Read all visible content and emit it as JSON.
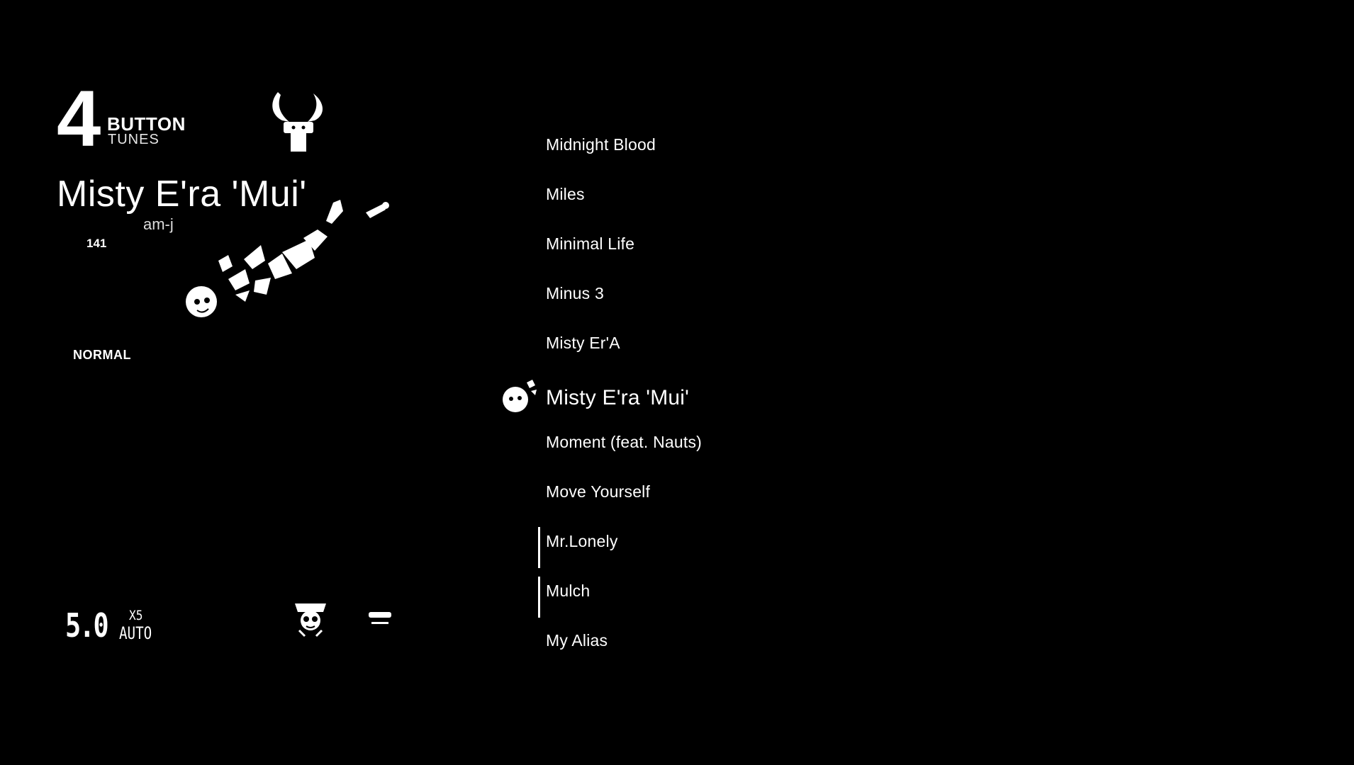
{
  "header": {
    "mode_number": "4",
    "mode_button": "BUTTON",
    "mode_tunes": "TUNES"
  },
  "selected_song": {
    "title": "Misty E'ra 'Mui'",
    "artist": "am-j",
    "bpm": "141",
    "difficulty": "NORMAL"
  },
  "settings": {
    "speed": "5.0",
    "multiplier": "X5",
    "fever": "AUTO"
  },
  "song_list": {
    "items": [
      {
        "title": "Midnight Blood",
        "selected": false
      },
      {
        "title": "Miles",
        "selected": false
      },
      {
        "title": "Minimal Life",
        "selected": false
      },
      {
        "title": "Minus 3",
        "selected": false
      },
      {
        "title": "Misty Er'A",
        "selected": false
      },
      {
        "title": "Misty E'ra 'Mui'",
        "selected": true
      },
      {
        "title": "Moment (feat. Nauts)",
        "selected": false
      },
      {
        "title": "Move Yourself",
        "selected": false
      },
      {
        "title": "Mr.Lonely",
        "selected": false
      },
      {
        "title": "Mulch",
        "selected": false
      },
      {
        "title": "My Alias",
        "selected": false
      }
    ]
  },
  "icons": {
    "mode_mascot": "antler-mascot-icon",
    "artwork": "character-artwork",
    "character": "character-portrait-icon",
    "gear": "gear-icon",
    "list_icon": "character-head-icon"
  },
  "colors": {
    "background": "#000000",
    "foreground": "#ffffff"
  }
}
